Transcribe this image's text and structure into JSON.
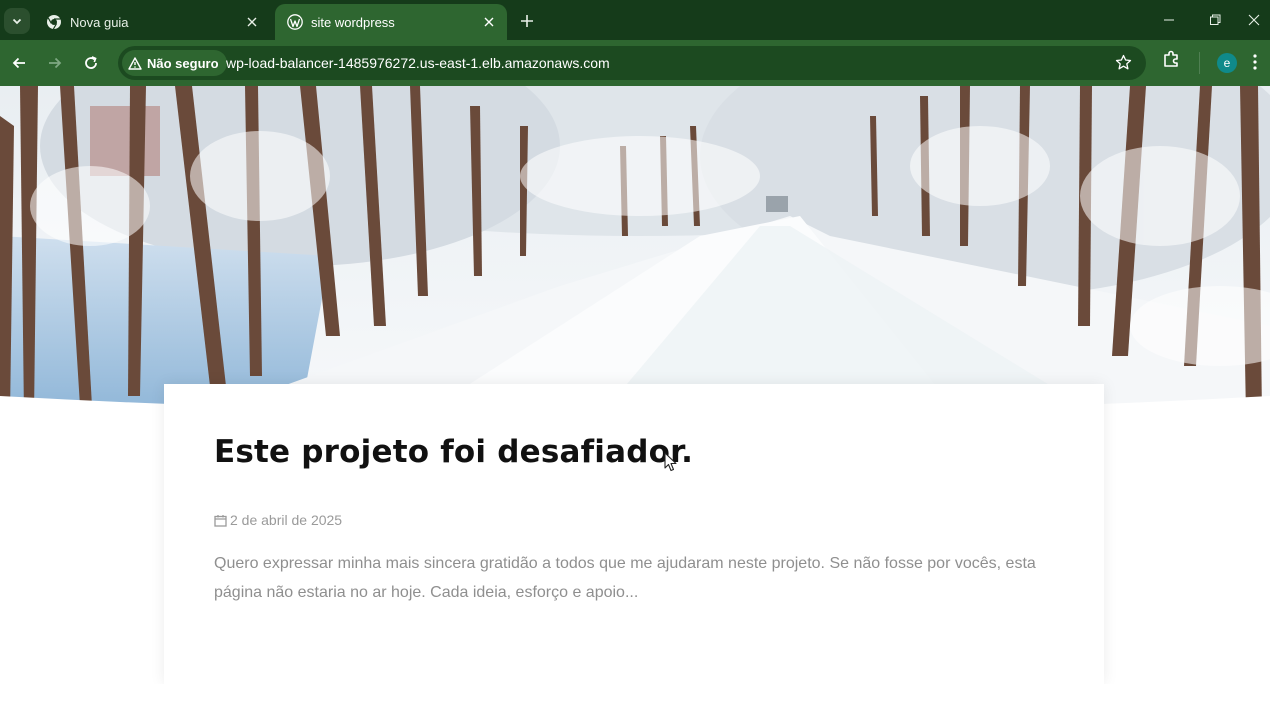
{
  "browser": {
    "tabs": [
      {
        "title": "Nova guia",
        "favicon": "chrome-icon",
        "active": false
      },
      {
        "title": "site wordpress",
        "favicon": "wordpress-icon",
        "active": true
      }
    ],
    "security_label": "Não seguro",
    "url": "wp-load-balancer-1485976272.us-east-1.elb.amazonaws.com",
    "profile_initial": "e",
    "colors": {
      "tabbar": "#153b1a",
      "toolbar": "#2e6630",
      "omnibox": "#1c4a20",
      "avatar": "#0f8a8a"
    }
  },
  "post": {
    "title": "Este projeto foi desafiador.",
    "date": "2 de abril de 2025",
    "excerpt": "Quero expressar minha mais sincera gratidão a todos que me ajudaram neste projeto. Se não fosse por vocês, esta página não estaria no ar hoje. Cada ideia, esforço e apoio..."
  }
}
